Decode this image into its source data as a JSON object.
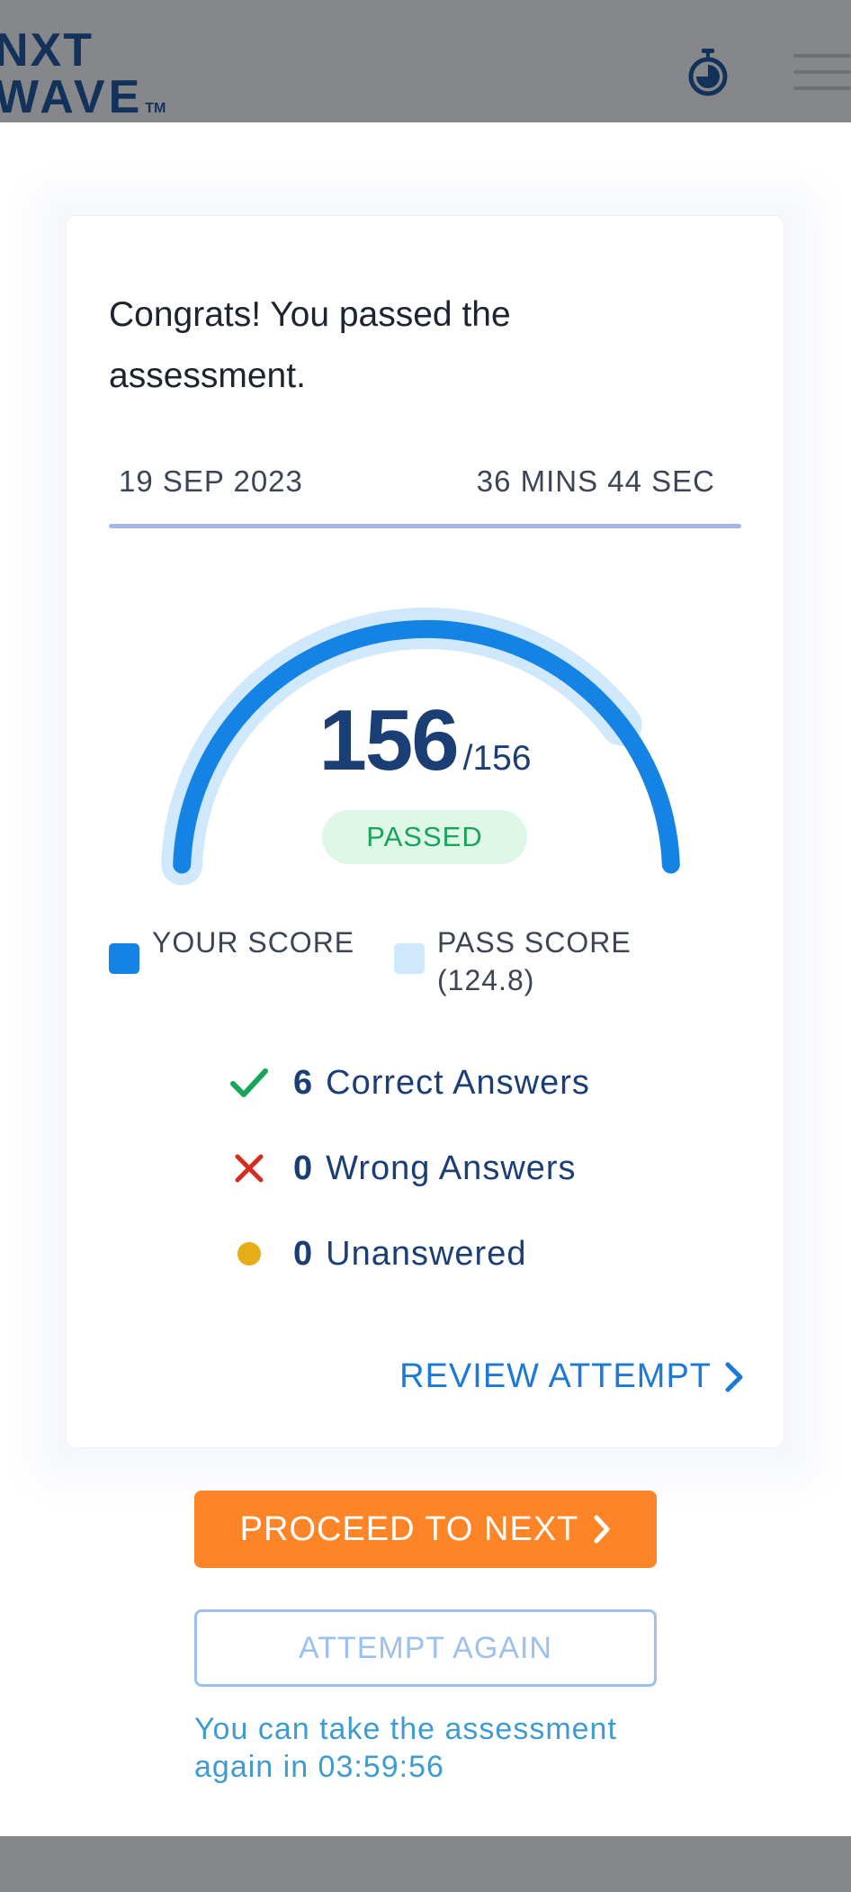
{
  "header": {
    "logo_line1": "NXT",
    "logo_line2": "WAVE",
    "logo_tm": "TM"
  },
  "result": {
    "title": "Congrats! You passed the assessment.",
    "date": "19 SEP 2023",
    "duration": "36 MINS 44 SEC",
    "score": "156",
    "total": "/156",
    "status": "PASSED",
    "gauge": {
      "score": 156,
      "max": 156,
      "pass_score": 124.8
    }
  },
  "legend": {
    "your_score": "YOUR SCORE",
    "pass_score": "PASS SCORE (124.8)"
  },
  "stats": {
    "correct_count": "6",
    "correct_label": "Correct Answers",
    "wrong_count": "0",
    "wrong_label": "Wrong Answers",
    "unanswered_count": "0",
    "unanswered_label": "Unanswered"
  },
  "actions": {
    "review": "REVIEW ATTEMPT",
    "proceed": "PROCEED TO NEXT",
    "attempt_again": "ATTEMPT AGAIN",
    "retry_note": "You can take the assessment again in 03:59:56"
  },
  "colors": {
    "header_bg": "#86878b",
    "brand_navy": "#13325a",
    "score_arc": "#1583e3",
    "pass_arc": "#cfe8fb",
    "passed_badge_bg": "#dff7e7",
    "passed_badge_text": "#17a55a",
    "proceed_bg": "#fe8527",
    "link_blue": "#1c7ad6",
    "correct": "#17a55a",
    "wrong": "#d62c1f",
    "unanswered": "#e6ad16"
  },
  "icons": {
    "timer": "stopwatch-icon",
    "menu": "hamburger-menu-icon",
    "correct": "check-icon",
    "wrong": "cross-icon",
    "unanswered": "dot-icon",
    "chevron": "chevron-right-icon"
  }
}
